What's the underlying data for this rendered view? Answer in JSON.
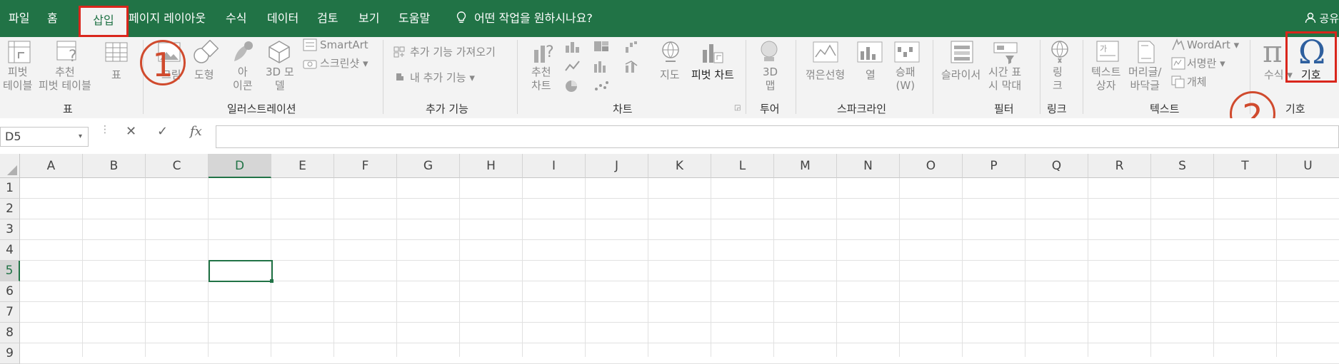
{
  "tabs": [
    "파일",
    "홈",
    "삽입",
    "페이지 레이아웃",
    "수식",
    "데이터",
    "검토",
    "보기",
    "도움말"
  ],
  "active_tab": "삽입",
  "tell_me": "어떤 작업을 원하시나요?",
  "share": "공유",
  "ribbon": {
    "tables": {
      "pivot": "피벗\n테이블",
      "recommended_pivot": "추천\n피벗 테이블",
      "table": "표",
      "group": "표"
    },
    "illustrations": {
      "picture": "그림",
      "shapes": "도형",
      "icons": "아\n이콘",
      "model3d": "3D 모\n델",
      "smartart": "SmartArt",
      "screenshot": "스크린샷",
      "group": "일러스트레이션"
    },
    "addins": {
      "get": "추가 기능 가져오기",
      "my": "내 추가 기능",
      "group": "추가 기능"
    },
    "charts": {
      "recommended": "추천\n차트",
      "maps": "지도",
      "pivot_chart": "피벗 차트",
      "group": "차트"
    },
    "tours": {
      "map3d": "3D\n맵",
      "group": "투어"
    },
    "sparklines": {
      "line": "꺾은선형",
      "column": "열",
      "winloss": "승패\n(W)",
      "group": "스파크라인"
    },
    "filters": {
      "slicer": "슬라이서",
      "timeline": "시간 표\n시 막대",
      "group": "필터"
    },
    "links": {
      "link": "링\n크",
      "group": "링크"
    },
    "text": {
      "textbox": "텍스트\n상자",
      "header_footer": "머리글/\n바닥글",
      "wordart": "WordArt",
      "signature": "서명란",
      "object": "개체",
      "group": "텍스트"
    },
    "symbols": {
      "equation": "수식",
      "symbol": "기호",
      "group": "기호"
    }
  },
  "annotations": {
    "one": "1",
    "two": "2"
  },
  "name_box": "D5",
  "formula_value": "",
  "columns": [
    "A",
    "B",
    "C",
    "D",
    "E",
    "F",
    "G",
    "H",
    "I",
    "J",
    "K",
    "L",
    "M",
    "N",
    "O",
    "P",
    "Q",
    "R",
    "S",
    "T",
    "U"
  ],
  "rows": [
    "1",
    "2",
    "3",
    "4",
    "5",
    "6",
    "7",
    "8",
    "9"
  ],
  "selected_cell": "D5",
  "colors": {
    "excel_green": "#217346",
    "annotation_red": "#d9261c",
    "circle_orange": "#d04a2d"
  }
}
